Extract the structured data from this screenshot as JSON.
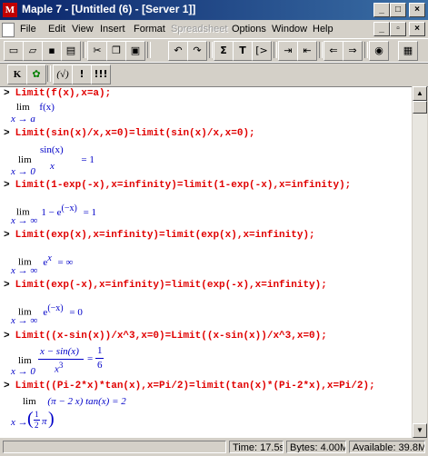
{
  "window": {
    "title": "Maple 7 - [Untitled (6) - [Server 1]]",
    "app_icon": "maple-leaf-icon",
    "min": "_",
    "max": "□",
    "close": "×"
  },
  "menu": {
    "file": "File",
    "edit": "Edit",
    "view": "View",
    "insert": "Insert",
    "format": "Format",
    "spreadsheet": "Spreadsheet",
    "options": "Options",
    "window": "Window",
    "help": "Help"
  },
  "toolbar1": [
    "new-icon",
    "open-icon",
    "save-icon",
    "print-icon",
    "cut-icon",
    "copy-icon",
    "paste-icon",
    "undo-icon",
    "redo-icon",
    "sigma-icon",
    "text-icon",
    "prompt-icon",
    "indent-icon",
    "outdent-icon",
    "back-icon",
    "forward-icon",
    "stop-icon",
    "zoom-icon"
  ],
  "toolbar2": {
    "k_label": "K",
    "leaf_icon": "maple-leaf-icon",
    "b1": "(√)",
    "b2": "!",
    "b3": "!!!"
  },
  "worksheet": {
    "prompt": ">",
    "cmd1": "Limit(f(x),x=a);",
    "out1": {
      "lim": "lim",
      "expr": "f(x)",
      "sub": "x → a"
    },
    "cmd2": "Limit(sin(x)/x,x=0)=limit(sin(x)/x,x=0);",
    "out2": {
      "lim": "lim",
      "num": "sin(x)",
      "den": "x",
      "rhs": "= 1",
      "sub": "x → 0"
    },
    "cmd3": "Limit(1-exp(-x),x=infinity)=limit(1-exp(-x),x=infinity);",
    "out3": {
      "lim": "lim",
      "expr": "1 − e",
      "sup": "(−x)",
      "rhs": "= 1",
      "sub": "x → ∞"
    },
    "cmd4": "Limit(exp(x),x=infinity)=limit(exp(x),x=infinity);",
    "out4": {
      "lim": "lim",
      "expr": "e",
      "sup": "x",
      "rhs": "= ∞",
      "sub": "x → ∞"
    },
    "cmd5": "Limit(exp(-x),x=infinity)=limit(exp(-x),x=infinity);",
    "out5": {
      "lim": "lim",
      "expr": "e",
      "sup": "(−x)",
      "rhs": "= 0",
      "sub": "x → ∞"
    },
    "cmd6": "Limit((x-sin(x))/x^3,x=0)=Limit((x-sin(x))/x^3,x=0);",
    "out6": {
      "lim": "lim",
      "num": "x − sin(x)",
      "den": "x",
      "den_sup": "3",
      "rhs": "=",
      "rnum": "1",
      "rden": "6",
      "sub": "x → 0"
    },
    "cmd7": "Limit((Pi-2*x)*tan(x),x=Pi/2)=limit(tan(x)*(Pi-2*x),x=Pi/2);",
    "out7": {
      "lim": "lim",
      "expr": "(π − 2 x) tan(x) = 2",
      "sub_x": "x → ",
      "half_num": "1",
      "half_den": "2",
      "pi": "π"
    }
  },
  "status": {
    "time": "Time: 17.5s",
    "bytes": "Bytes: 4.00M",
    "available": "Available: 39.8M"
  }
}
